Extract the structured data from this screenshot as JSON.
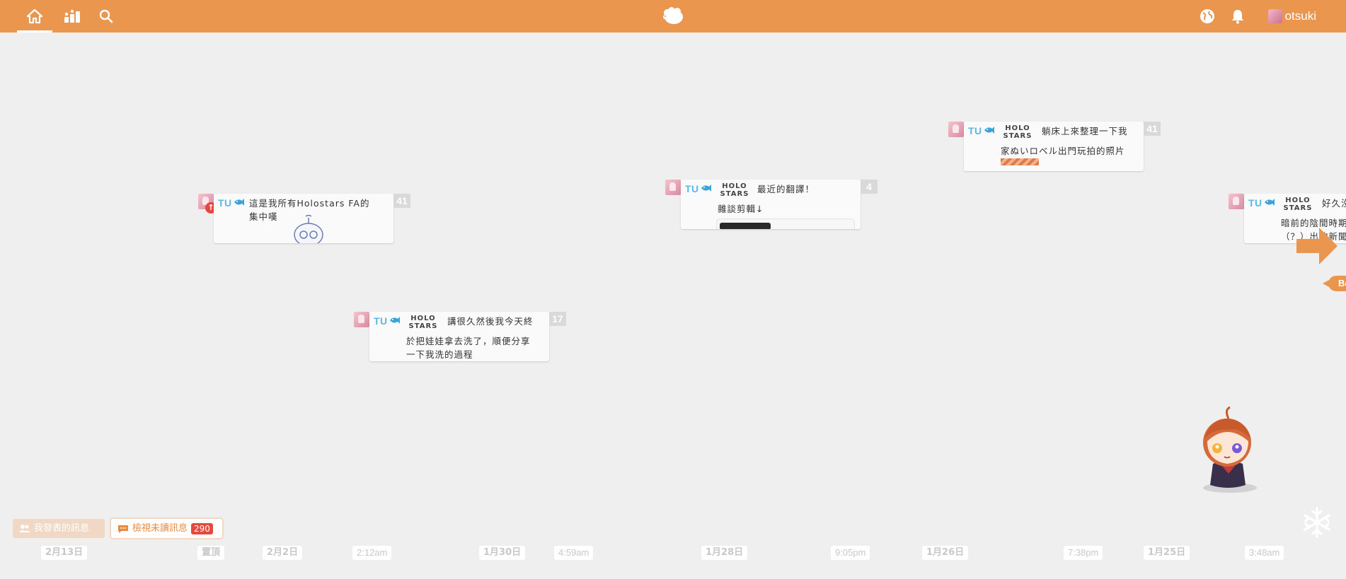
{
  "topbar": {
    "username": "otsuki",
    "colors": {
      "bar": "#ea964e",
      "active_underline": "#ffffff"
    },
    "icons": [
      "home-icon",
      "ranking-icon",
      "search-icon",
      "sheep-logo-icon",
      "globe-icon",
      "bell-icon"
    ]
  },
  "cards": [
    {
      "author": "TU",
      "text_line1": "這是我所有Holostars FA的",
      "text_line2": "集中嘆",
      "count": "41",
      "badge": "↑"
    },
    {
      "author": "TU",
      "holo": "HOLO STARS",
      "text_line1": "講很久然後我今天終",
      "text_line2": "於把娃娃拿去洗了，順便分享",
      "text_line3": "一下我洗的過程",
      "count": "17"
    },
    {
      "author": "TU",
      "holo": "HOLO STARS",
      "text_line1": "最近的翻譯！",
      "text_line2": "雜談剪輯↓",
      "count": "4"
    },
    {
      "author": "TU",
      "holo": "HOLO STARS",
      "text_line1": "躺床上來整理一下我",
      "text_line2": "家ぬいロベル出門玩拍的照片",
      "count": "41"
    },
    {
      "author": "TU",
      "holo": "HOLO STARS",
      "text_line1": "好久沒",
      "text_line2": "暗前的陰間時期",
      "text_line3": "（？）出的新聞"
    }
  ],
  "bottom": {
    "my_posts_label": "我發表的訊息",
    "unread_label": "檢視未讀訊息",
    "unread_count": "290",
    "begin_label": "Begin"
  },
  "timeline": [
    {
      "label": "2月13日",
      "kind": "date"
    },
    {
      "label": "置頂",
      "kind": "date"
    },
    {
      "label": "2月2日",
      "kind": "date"
    },
    {
      "label": "2:12am",
      "kind": "time"
    },
    {
      "label": "1月30日",
      "kind": "date"
    },
    {
      "label": "4:59am",
      "kind": "time"
    },
    {
      "label": "1月28日",
      "kind": "date"
    },
    {
      "label": "9:05pm",
      "kind": "time"
    },
    {
      "label": "1月26日",
      "kind": "date"
    },
    {
      "label": "7:38pm",
      "kind": "time"
    },
    {
      "label": "1月25日",
      "kind": "date"
    },
    {
      "label": "3:48am",
      "kind": "time"
    }
  ]
}
